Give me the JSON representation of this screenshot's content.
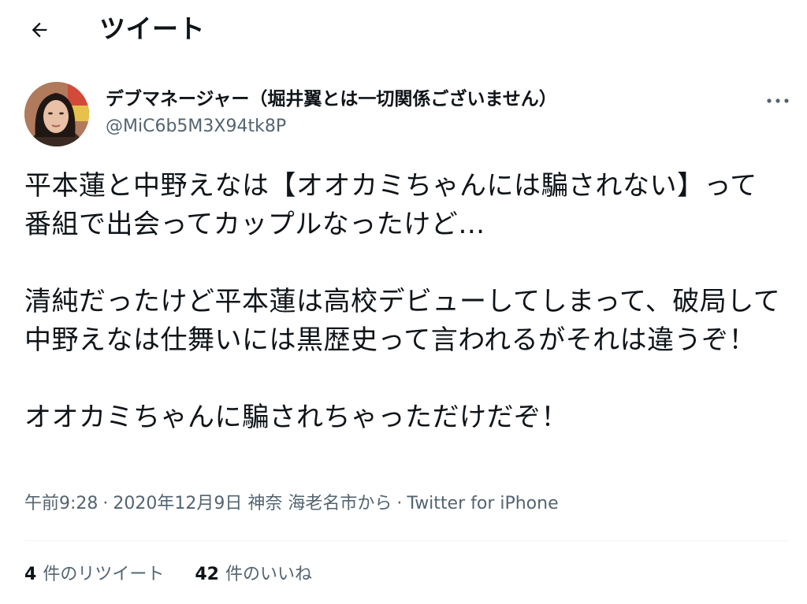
{
  "header": {
    "title": "ツイート",
    "back_icon": "arrow-left-icon"
  },
  "author": {
    "display_name": "デブマネージャー（堀井翼とは一切関係ございません）",
    "handle": "@MiC6b5M3X94tk8P",
    "more_icon": "more-horizontal-icon"
  },
  "tweet": {
    "text": "平本蓮と中野えなは【オオカミちゃんには騙されない】って番組で出会ってカップルなったけど…\n\n清純だったけど平本蓮は高校デビューしてしまって、破局して中野えなは仕舞いには黒歴史って言われるがそれは違うぞ！\n\nオオカミちゃんに騙されちゃっただけだぞ！"
  },
  "meta": {
    "time": "午前9:28",
    "date": "2020年12月9日",
    "location": "神奈 海老名市から",
    "source": "Twitter for iPhone",
    "separator": "·"
  },
  "stats": {
    "retweet_count": "4",
    "retweet_label": "件のリツイート",
    "like_count": "42",
    "like_label": "件のいいね"
  }
}
